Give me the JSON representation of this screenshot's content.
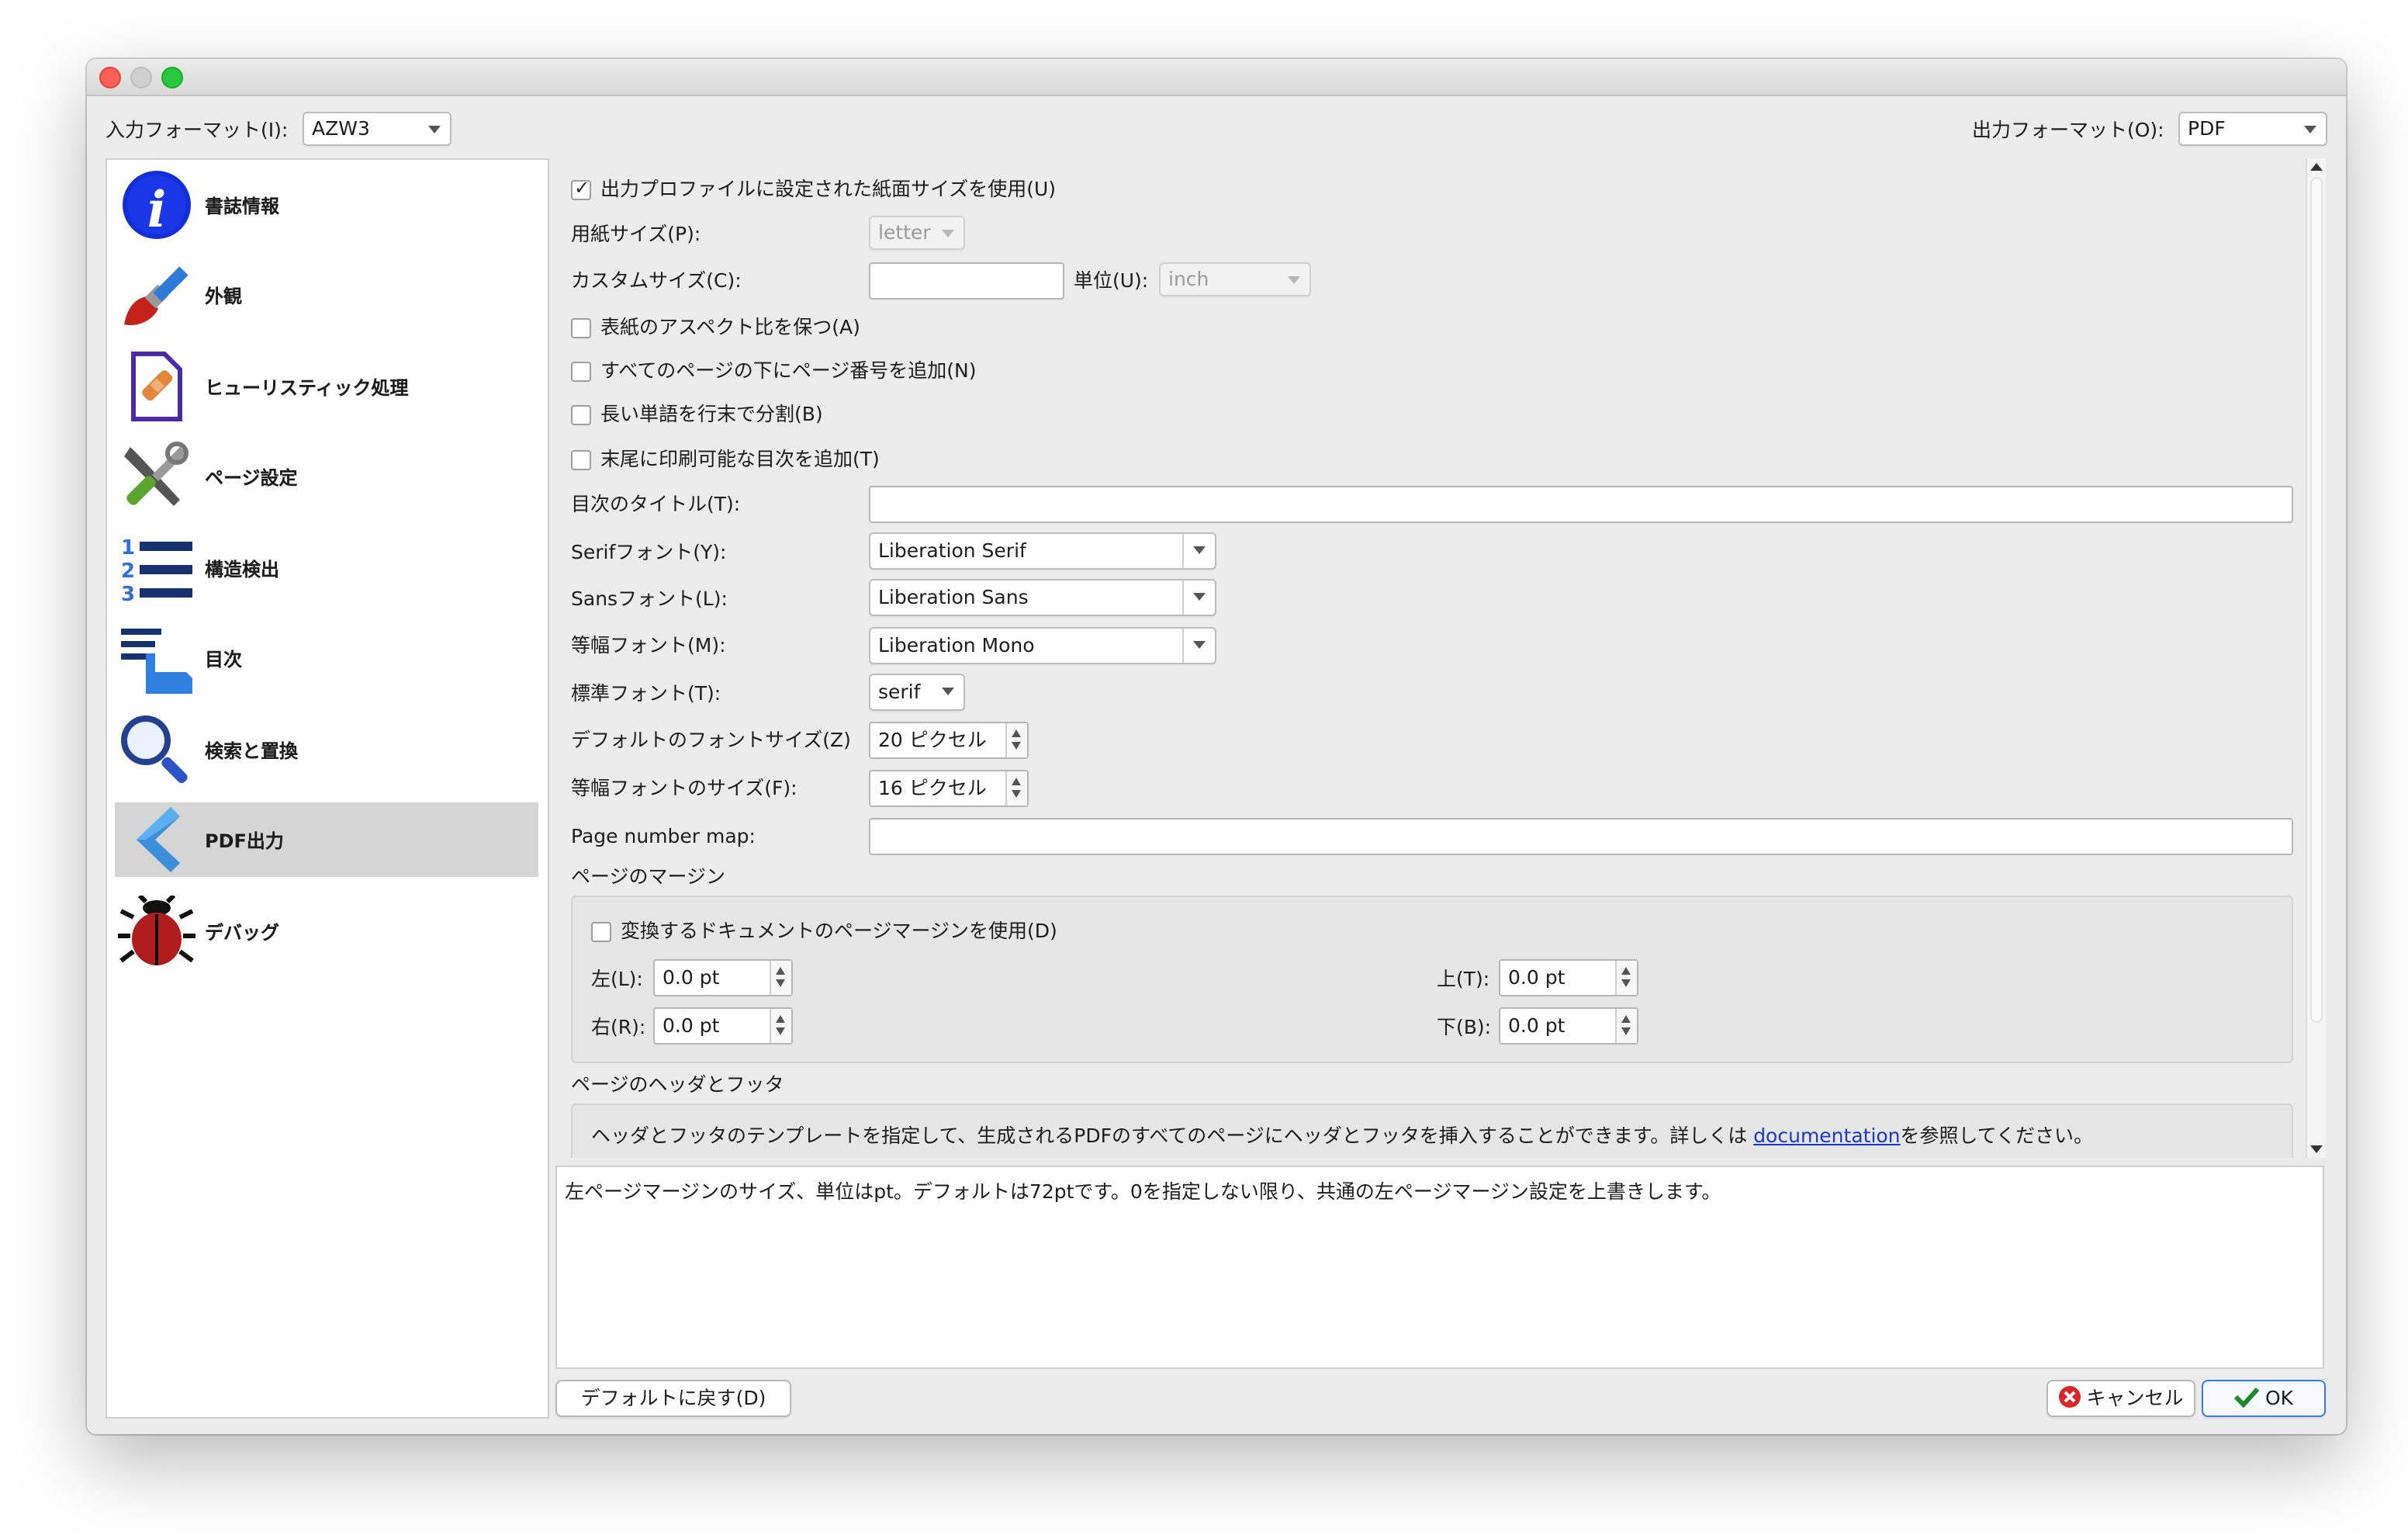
{
  "toolbar": {
    "input_format_label": "入力フォーマット(I):",
    "input_format_value": "AZW3",
    "output_format_label": "出力フォーマット(O):",
    "output_format_value": "PDF"
  },
  "sidebar": {
    "items": [
      {
        "label": "書誌情報",
        "icon": "info-icon"
      },
      {
        "label": "外観",
        "icon": "paintbrush-icon"
      },
      {
        "label": "ヒューリスティック処理",
        "icon": "bandaid-document-icon"
      },
      {
        "label": "ページ設定",
        "icon": "tools-icon"
      },
      {
        "label": "構造検出",
        "icon": "numbered-list-icon"
      },
      {
        "label": "目次",
        "icon": "toc-pointer-icon"
      },
      {
        "label": "検索と置換",
        "icon": "magnifier-icon"
      },
      {
        "label": "PDF出力",
        "icon": "pdf-chevron-icon",
        "selected": true
      },
      {
        "label": "デバッグ",
        "icon": "bug-icon"
      }
    ]
  },
  "options": {
    "use_profile_size": {
      "label": "出力プロファイルに設定された紙面サイズを使用(U)",
      "checked": true
    },
    "paper_size": {
      "label": "用紙サイズ(P):",
      "value": "letter"
    },
    "custom_size": {
      "label": "カスタムサイズ(C):",
      "value": ""
    },
    "unit": {
      "label": "単位(U):",
      "value": "inch"
    },
    "preserve_cover_aspect": {
      "label": "表紙のアスペクト比を保つ(A)",
      "checked": false
    },
    "page_numbers": {
      "label": "すべてのページの下にページ番号を追加(N)",
      "checked": false
    },
    "hyphenate": {
      "label": "長い単語を行末で分割(B)",
      "checked": false
    },
    "add_toc": {
      "label": "末尾に印刷可能な目次を追加(T)",
      "checked": false
    },
    "toc_title": {
      "label": "目次のタイトル(T):",
      "value": ""
    },
    "serif_font": {
      "label": "Serifフォント(Y):",
      "value": "Liberation Serif"
    },
    "sans_font": {
      "label": "Sansフォント(L):",
      "value": "Liberation Sans"
    },
    "mono_font": {
      "label": "等幅フォント(M):",
      "value": "Liberation Mono"
    },
    "standard_font": {
      "label": "標準フォント(T):",
      "value": "serif"
    },
    "default_font_size": {
      "label": "デフォルトのフォントサイズ(Z)",
      "value": "20 ピクセル"
    },
    "mono_font_size": {
      "label": "等幅フォントのサイズ(F):",
      "value": "16 ピクセル"
    },
    "page_number_map": {
      "label": "Page number map:",
      "value": ""
    }
  },
  "margins": {
    "title": "ページのマージン",
    "use_doc_margins": {
      "label": "変換するドキュメントのページマージンを使用(D)",
      "checked": false
    },
    "left": {
      "label": "左(L):",
      "value": "0.0 pt"
    },
    "right": {
      "label": "右(R):",
      "value": "0.0 pt"
    },
    "top": {
      "label": "上(T):",
      "value": "0.0 pt"
    },
    "bottom": {
      "label": "下(B):",
      "value": "0.0 pt"
    }
  },
  "header_footer": {
    "title": "ページのヘッダとフッタ",
    "text_before": "ヘッダとフッタのテンプレートを指定して、生成されるPDFのすべてのページにヘッダとフッタを挿入することができます。詳しくは ",
    "link": "documentation",
    "text_after": "を参照してください。"
  },
  "help_text": "左ページマージンのサイズ、単位はpt。デフォルトは72ptです。0を指定しない限り、共通の左ページマージン設定を上書きします。",
  "buttons": {
    "restore_defaults": "デフォルトに戻す(D)",
    "cancel": "キャンセル",
    "ok": "OK"
  }
}
